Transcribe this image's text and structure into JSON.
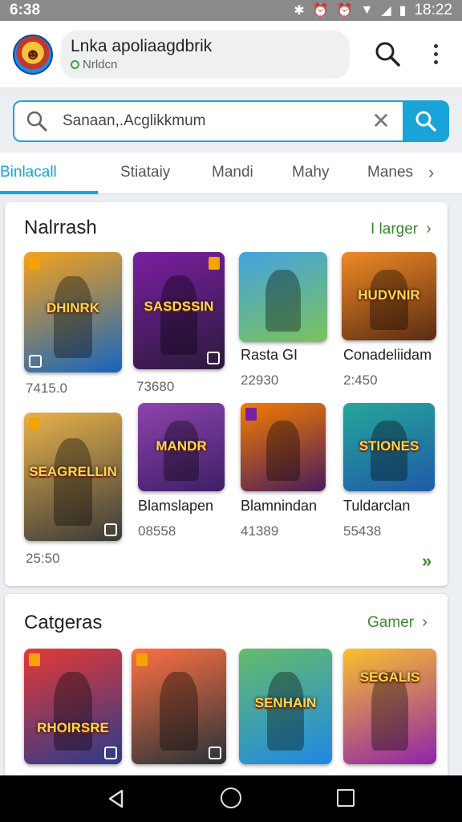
{
  "status_bar": {
    "time_left": "6:38",
    "time_right": "18:22"
  },
  "app_header": {
    "title": "Lnka apoliaagdbrik",
    "subtitle": "Nrldcn"
  },
  "search": {
    "query": "Sanaan,.Acglikkmum"
  },
  "tabs": [
    {
      "label": "Binlacall",
      "active": true
    },
    {
      "label": "Stiataiy",
      "active": false
    },
    {
      "label": "Mandi",
      "active": false
    },
    {
      "label": "Mahy",
      "active": false
    },
    {
      "label": "Manes",
      "active": false
    }
  ],
  "section_one": {
    "title": "Nalrrash",
    "link_label": "I larger",
    "row1": [
      {
        "emblem": "DHINRK",
        "name": "",
        "count": "7415.0",
        "colors": [
          "#f6a21a",
          "#1565c0"
        ]
      },
      {
        "emblem": "SASDSSIN",
        "name": "",
        "count": "73680",
        "colors": [
          "#7b1fa2",
          "#2b1a3c"
        ]
      },
      {
        "emblem": "",
        "name": "Rasta GI",
        "count": "22930",
        "colors": [
          "#43a3e0",
          "#7cc25a"
        ]
      },
      {
        "emblem": "HUDVNIR",
        "name": "Conadeliidam",
        "count": "2:450",
        "colors": [
          "#f08a24",
          "#5a2b14"
        ]
      }
    ],
    "row2": [
      {
        "emblem": "SEAGRELLIN",
        "name": "",
        "count": "25:50",
        "colors": [
          "#e8b24a",
          "#3a3a3a"
        ]
      },
      {
        "emblem": "MANDR",
        "name": "Blamslapen",
        "count": "08558",
        "colors": [
          "#8e44ad",
          "#3d1f66"
        ]
      },
      {
        "emblem": "",
        "name": "Blamnindan",
        "count": "41389",
        "colors": [
          "#f57c00",
          "#4a1c5c"
        ]
      },
      {
        "emblem": "STIONES",
        "name": "Tuldarclan",
        "count": "55438",
        "colors": [
          "#26a69a",
          "#1e5aa8"
        ]
      }
    ]
  },
  "section_two": {
    "title": "Catgeras",
    "link_label": "Gamer",
    "tiles": [
      {
        "emblem": "RHOIRSRE",
        "colors": [
          "#e53935",
          "#2b3a8c"
        ]
      },
      {
        "emblem": "",
        "colors": [
          "#ff7043",
          "#263238"
        ]
      },
      {
        "emblem": "SENHAIN",
        "colors": [
          "#66bb6a",
          "#1e88e5"
        ]
      },
      {
        "emblem": "SEGALIS",
        "colors": [
          "#fbc02d",
          "#8e24aa"
        ]
      }
    ]
  }
}
